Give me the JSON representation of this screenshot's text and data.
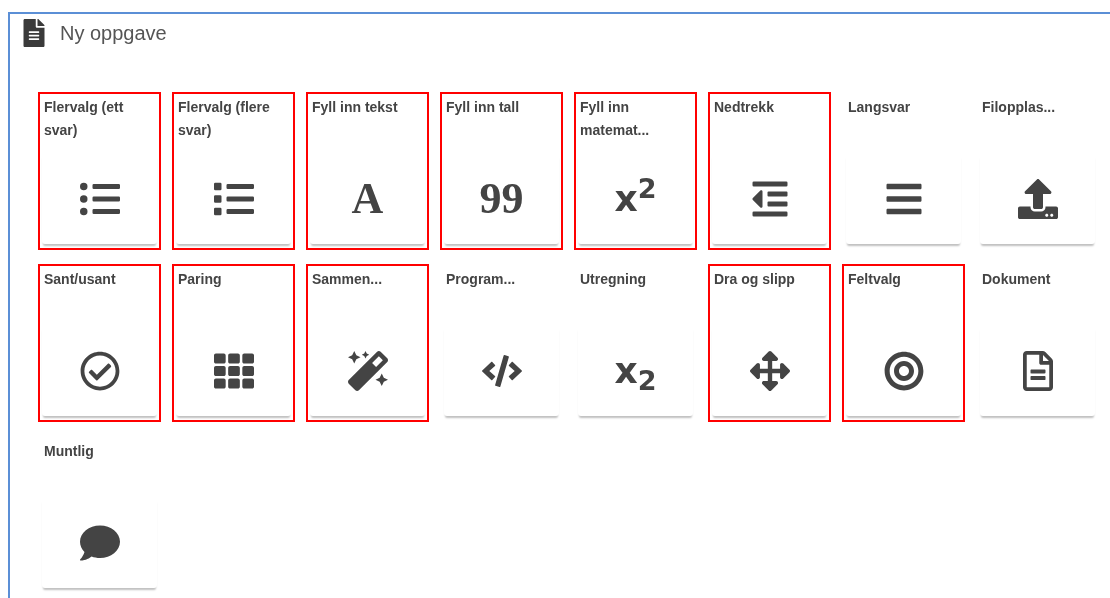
{
  "header": {
    "title": "Ny oppgave"
  },
  "tiles": [
    {
      "label": "Flervalg (ett svar)",
      "highlighted": true,
      "kind": "bullet-list"
    },
    {
      "label": "Flervalg (flere svar)",
      "highlighted": true,
      "kind": "list"
    },
    {
      "label": "Fyll inn tekst",
      "highlighted": true,
      "kind": "serif-glyph",
      "glyph": "A"
    },
    {
      "label": "Fyll inn tall",
      "highlighted": true,
      "kind": "serif-glyph",
      "glyph": "99"
    },
    {
      "label": "Fyll inn matemat...",
      "highlighted": true,
      "kind": "glyph",
      "glyph": "x$^{2}$"
    },
    {
      "label": "Nedtrekk",
      "highlighted": true,
      "kind": "outdent"
    },
    {
      "label": "Langsvar",
      "highlighted": false,
      "kind": "lines"
    },
    {
      "label": "Filopplas...",
      "highlighted": false,
      "kind": "upload"
    },
    {
      "label": "Sant/usant",
      "highlighted": true,
      "kind": "check"
    },
    {
      "label": "Paring",
      "highlighted": true,
      "kind": "grid"
    },
    {
      "label": "Sammen...",
      "highlighted": true,
      "kind": "wand"
    },
    {
      "label": "Program...",
      "highlighted": false,
      "kind": "code"
    },
    {
      "label": "Utregning",
      "highlighted": false,
      "kind": "glyph",
      "glyph": "x$_{2}$"
    },
    {
      "label": "Dra og slipp",
      "highlighted": true,
      "kind": "move"
    },
    {
      "label": "Feltvalg",
      "highlighted": true,
      "kind": "target"
    },
    {
      "label": "Dokument",
      "highlighted": false,
      "kind": "document"
    },
    {
      "label": "Muntlig",
      "highlighted": false,
      "kind": "speech"
    }
  ]
}
